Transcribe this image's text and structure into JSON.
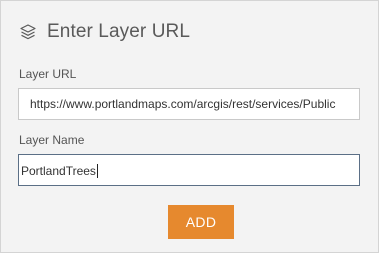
{
  "header": {
    "title": "Enter Layer URL",
    "icon": "layers-icon"
  },
  "form": {
    "url_label": "Layer URL",
    "url_value": "https://www.portlandmaps.com/arcgis/rest/services/Public",
    "name_label": "Layer Name",
    "name_value": "PortlandTrees"
  },
  "actions": {
    "add_label": "ADD"
  },
  "colors": {
    "panel_background": "#f3f3f3",
    "button_accent": "#e6892e",
    "focused_border": "#5b6f86"
  }
}
